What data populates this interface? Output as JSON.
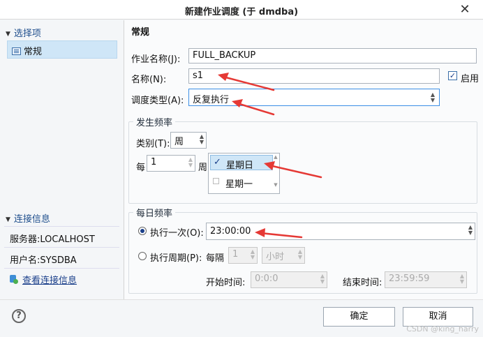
{
  "window": {
    "title": "新建作业调度 (于 dmdba)",
    "close_glyph": "✕"
  },
  "sidebar": {
    "options_header": "选择项",
    "nav_items": [
      {
        "label": "常规"
      }
    ],
    "connection_header": "连接信息",
    "server": "服务器:LOCALHOST",
    "user": "用户名:SYSDBA",
    "view_connection_link": "查看连接信息",
    "collapse_glyph": "▼"
  },
  "general": {
    "section_title": "常规",
    "job_name_label": "作业名称(J):",
    "job_name_value": "FULL_BACKUP",
    "name_label": "名称(N):",
    "name_value": "s1",
    "enable_label": "启用",
    "enable_checked": true,
    "schedule_type_label": "调度类型(A):",
    "schedule_type_value": "反复执行"
  },
  "frequency": {
    "group_title": "发生频率",
    "type_label": "类别(T):",
    "type_value": "周",
    "every_label": "每",
    "every_value": "1",
    "unit_label": "周",
    "weekdays": [
      {
        "label": "星期日",
        "checked": true
      },
      {
        "label": "星期一",
        "checked": false
      }
    ],
    "check_glyph": "✓"
  },
  "daily": {
    "group_title": "每日频率",
    "once_label": "执行一次(O):",
    "once_value": "23:00:00",
    "once_selected": true,
    "period_label": "执行周期(P):",
    "interval_label": "每隔",
    "interval_value": "1",
    "interval_unit": "小时",
    "start_label": "开始时间:",
    "start_value": "0:0:0",
    "end_label": "结束时间:",
    "end_value": "23:59:59"
  },
  "buttons": {
    "ok": "确定",
    "cancel": "取消",
    "help": "?"
  },
  "watermark": "CSDN @king_harry",
  "colors": {
    "accent": "#1e4e8c",
    "selection": "#cfe6f7",
    "annotation_arrow": "#e53935"
  },
  "icons": [
    "close-icon",
    "collapse-icon",
    "form-icon",
    "database-icon",
    "checkmark-icon",
    "spinner-icon",
    "help-icon"
  ]
}
